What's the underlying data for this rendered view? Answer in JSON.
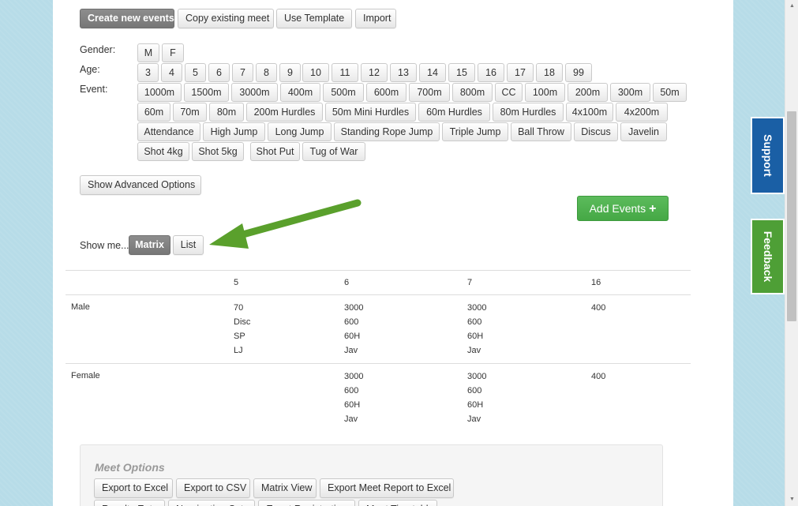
{
  "toolbar": {
    "create_new_events": "Create new events",
    "copy_existing_meet": "Copy existing meet",
    "use_template": "Use Template",
    "import": "Import"
  },
  "filters": {
    "gender_label": "Gender:",
    "age_label": "Age:",
    "event_label": "Event:",
    "genders": [
      "M",
      "F"
    ],
    "ages": [
      "3",
      "4",
      "5",
      "6",
      "7",
      "8",
      "9",
      "10",
      "11",
      "12",
      "13",
      "14",
      "15",
      "16",
      "17",
      "18",
      "99"
    ],
    "events_row1": [
      "1000m",
      "1500m",
      "3000m",
      "400m",
      "500m",
      "600m",
      "700m",
      "800m",
      "CC",
      "100m",
      "200m",
      "300m",
      "50m"
    ],
    "events_row2": [
      "60m",
      "70m",
      "80m",
      "200m Hurdles",
      "50m Mini Hurdles",
      "60m Hurdles",
      "80m Hurdles",
      "4x100m",
      "4x200m"
    ],
    "events_row3": [
      "Attendance",
      "High Jump",
      "Long Jump",
      "Standing Rope Jump",
      "Triple Jump",
      "Ball Throw",
      "Discus",
      "Javelin"
    ],
    "events_row4": [
      "Shot 4kg",
      "Shot 5kg",
      "Shot Put",
      "Tug of War"
    ]
  },
  "advanced": {
    "show_advanced_options": "Show Advanced Options"
  },
  "add_events": {
    "label": "Add Events",
    "icon": "plus-icon"
  },
  "view": {
    "show_me_label": "Show me...",
    "matrix": "Matrix",
    "list": "List",
    "active": "Matrix"
  },
  "annotation": {
    "arrow_color": "#5aa02c"
  },
  "matrix": {
    "columns": [
      "5",
      "6",
      "7",
      "16"
    ],
    "rows": [
      {
        "label": "Male",
        "cells": [
          [
            "70",
            "Disc",
            "SP",
            "LJ"
          ],
          [
            "3000",
            "600",
            "60H",
            "Jav"
          ],
          [
            "3000",
            "600",
            "60H",
            "Jav"
          ],
          [
            "400"
          ]
        ]
      },
      {
        "label": "Female",
        "cells": [
          [],
          [
            "3000",
            "600",
            "60H",
            "Jav"
          ],
          [
            "3000",
            "600",
            "60H",
            "Jav"
          ],
          [
            "400"
          ]
        ]
      }
    ]
  },
  "meet_options": {
    "title": "Meet Options",
    "row1": [
      "Export to Excel",
      "Export to CSV",
      "Matrix View",
      "Export Meet Report to Excel"
    ],
    "row2": [
      "Results Entry",
      "Nomination Setup",
      "Event Registration",
      "Meet Timetable"
    ]
  },
  "side_tabs": {
    "support": "Support",
    "feedback": "Feedback",
    "support_color": "#1a5fa5",
    "feedback_color": "#4e9f36"
  }
}
